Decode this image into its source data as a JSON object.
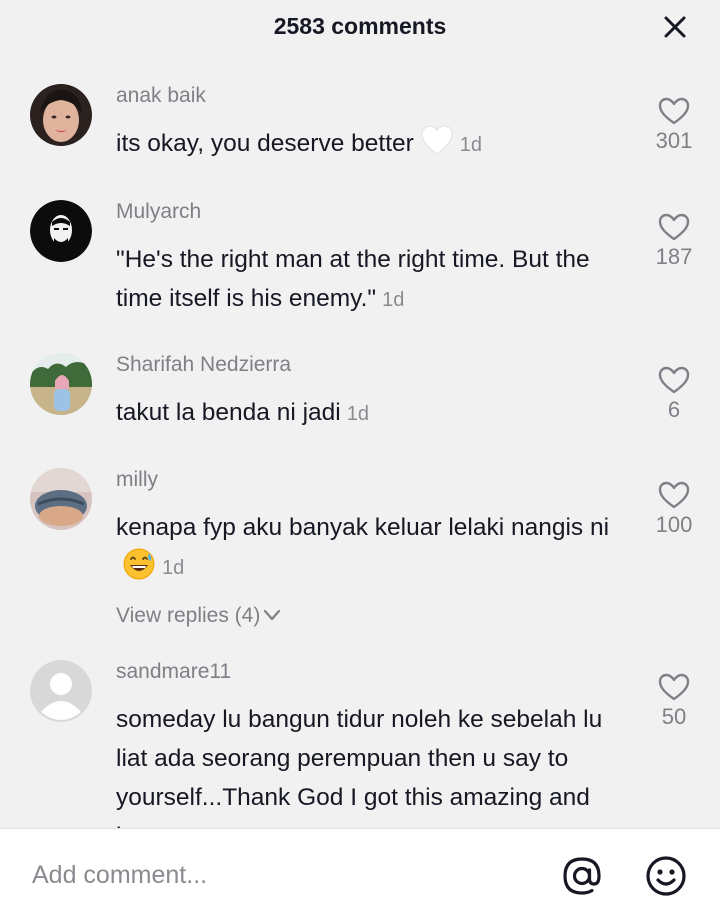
{
  "header": {
    "title": "2583 comments",
    "close_icon": "close-icon"
  },
  "comments": [
    {
      "username": "anak baik",
      "text": "its okay, you deserve better",
      "emoji": "white-heart",
      "time": "1d",
      "likes": "301"
    },
    {
      "username": "Mulyarch",
      "text": "\"He's the right man at the right time. But the time itself is his enemy.\"",
      "time": "1d",
      "likes": "187"
    },
    {
      "username": "Sharifah Nedzierra",
      "text": "takut la benda ni jadi",
      "time": "1d",
      "likes": "6"
    },
    {
      "username": "milly",
      "text": "kenapa fyp aku banyak keluar lelaki nangis ni",
      "emoji": "grinning-sweat-face",
      "time": "1d",
      "likes": "100",
      "view_replies": "View replies (4)"
    },
    {
      "username": "sandmare11",
      "text": "someday lu bangun tidur noleh ke sebelah lu liat ada seorang perempuan then u say to yourself...Thank God I got this amazing and better",
      "time": "",
      "likes": "50"
    }
  ],
  "footer": {
    "placeholder": "Add comment...",
    "mention_icon": "at-sign-icon",
    "emoji_icon": "smiley-icon"
  },
  "colors": {
    "background": "#f1f1f1",
    "text_primary": "#161823",
    "text_secondary": "#7f8087",
    "footer_bg": "#ffffff"
  }
}
